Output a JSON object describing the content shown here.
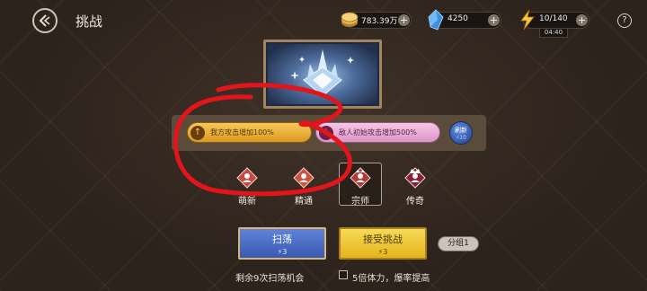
{
  "header": {
    "title": "挑战"
  },
  "resources": {
    "gold": "783.39万",
    "gems": "4250",
    "energy": "10/140",
    "energy_timer": "04:40",
    "help": "?"
  },
  "modifiers": {
    "buff": "我方攻击增加100%",
    "debuff": "敌人初始攻击增加500%",
    "refresh_label": "刷新",
    "refresh_cost": "10"
  },
  "difficulties": [
    {
      "label": "萌新",
      "color": "#c8473e"
    },
    {
      "label": "精通",
      "color": "#d0503f"
    },
    {
      "label": "宗师",
      "color": "#b23a37",
      "selected": true
    },
    {
      "label": "传奇",
      "color": "#8b1f3a"
    }
  ],
  "actions": {
    "sweep_label": "扫荡",
    "sweep_cost": "3",
    "challenge_label": "接受挑战",
    "challenge_cost": "3",
    "group_label": "分组1"
  },
  "footer": {
    "sweep_remaining": "剩余9次扫荡机会",
    "bonus_option": "5倍体力，爆率提高"
  },
  "colors": {
    "accent_gold": "#f2c84b",
    "accent_blue": "#4a6dc7",
    "annotation_red": "#e3141b"
  }
}
